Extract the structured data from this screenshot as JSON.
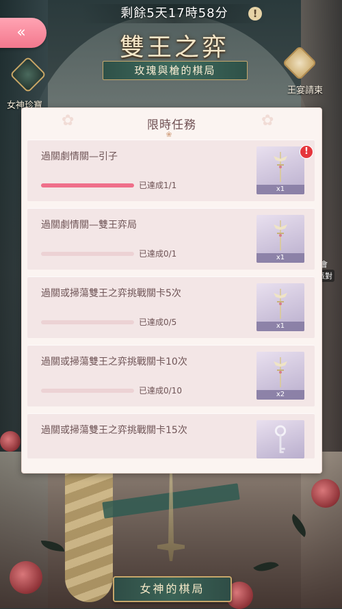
{
  "hud": {
    "timer_text": "剩餘5天17時58分",
    "alert_glyph": "!",
    "back_glyph": "«",
    "event_title": "雙王之弈",
    "event_subtitle": "玫瑰與槍的棋局",
    "left_icon_label": "女神珍寶",
    "right_icon_label": "王宴請柬",
    "right_small_text": "會",
    "right_tag_text": "派對"
  },
  "modal": {
    "title": "限時任務",
    "header_ornament": "❀",
    "tasks": [
      {
        "name": "過關劇情關—引子",
        "progress_text": "已達成1/1",
        "progress_fraction": 1.0,
        "reward_count": "x1",
        "reward_icon": "winged-sword-icon",
        "alert": true
      },
      {
        "name": "過關劇情關—雙王弈局",
        "progress_text": "已達成0/1",
        "progress_fraction": 0.0,
        "reward_count": "x1",
        "reward_icon": "winged-sword-icon",
        "alert": false
      },
      {
        "name": "過關或掃蕩雙王之弈挑戰關卡5次",
        "progress_text": "已達成0/5",
        "progress_fraction": 0.0,
        "reward_count": "x1",
        "reward_icon": "winged-sword-icon",
        "alert": false
      },
      {
        "name": "過關或掃蕩雙王之弈挑戰關卡10次",
        "progress_text": "已達成0/10",
        "progress_fraction": 0.0,
        "reward_count": "x2",
        "reward_icon": "winged-sword-icon",
        "alert": false
      },
      {
        "name": "過關或掃蕩雙王之弈挑戰關卡15次",
        "progress_text": "",
        "progress_fraction": 0.0,
        "reward_count": "",
        "reward_icon": "silver-key-icon",
        "alert": false
      }
    ],
    "alert_glyph": "!"
  },
  "bottom": {
    "button_label": "女神的棋局"
  },
  "colors": {
    "progress_fill": "#ef6f8a",
    "alert_red": "#e5363c",
    "back_button_pink": "#f3788d"
  }
}
